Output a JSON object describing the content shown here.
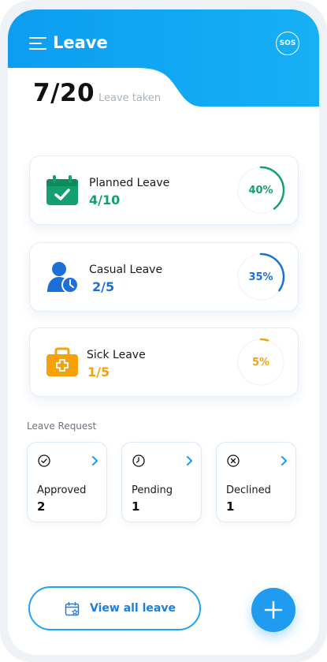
{
  "header": {
    "title": "Leave",
    "sos_label": "SOS"
  },
  "summary": {
    "taken": "7/20",
    "label": "Leave taken"
  },
  "colors": {
    "header": "#0ea5f0",
    "planned": "#14a06e",
    "casual": "#1d6fd8",
    "sick": "#f5a10a"
  },
  "cards": [
    {
      "name": "Planned Leave",
      "count": "4/10",
      "percent_label": "40%",
      "fraction": 0.4,
      "icon": "calendar-check-icon"
    },
    {
      "name": "Casual Leave",
      "count": "2/5",
      "percent_label": "35%",
      "fraction": 0.35,
      "icon": "user-clock-icon"
    },
    {
      "name": "Sick Leave",
      "count": "1/5",
      "percent_label": "5%",
      "fraction": 0.05,
      "icon": "medical-kit-icon"
    }
  ],
  "requests_title": "Leave Request",
  "requests": [
    {
      "name": "Approved",
      "count": "2",
      "icon": "check-circle-icon"
    },
    {
      "name": "Pending",
      "count": "1",
      "icon": "clock-icon"
    },
    {
      "name": "Declined",
      "count": "1",
      "icon": "x-circle-icon"
    }
  ],
  "footer": {
    "view_all_label": "View all leave",
    "add_icon": "plus-icon"
  }
}
